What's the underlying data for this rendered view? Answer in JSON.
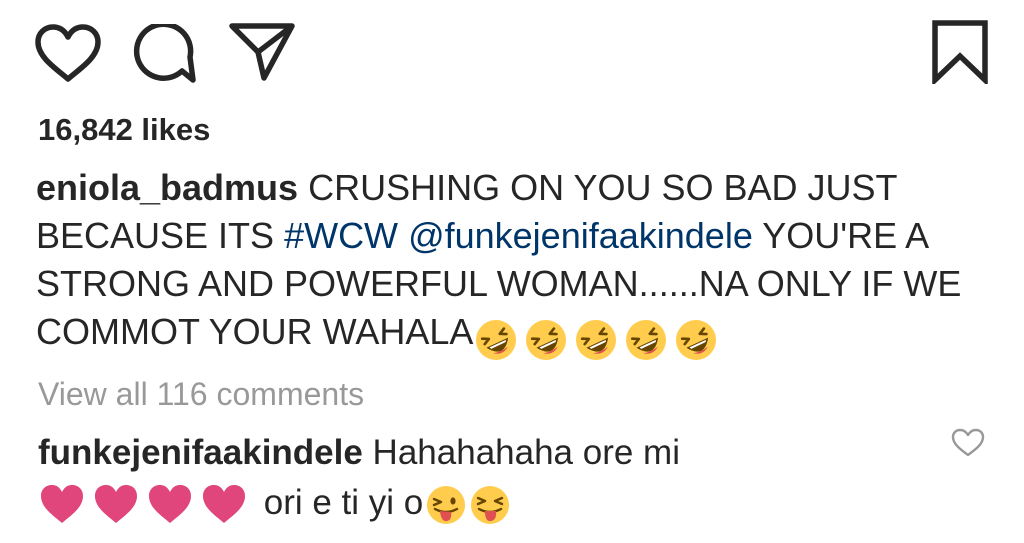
{
  "actions": {
    "like_icon": "heart-outline-icon",
    "comment_icon": "speech-bubble-icon",
    "share_icon": "paper-plane-icon",
    "save_icon": "bookmark-outline-icon"
  },
  "post": {
    "likes": "16,842 likes",
    "caption": {
      "username": "eniola_badmus",
      "text_1": " CRUSHING ON YOU SO BAD JUST BECAUSE ITS ",
      "hashtag": "#WCW",
      "space": " ",
      "mention": "@funkejenifaakindele",
      "text_2": " YOU'RE A STRONG AND POWERFUL WOMAN......NA ONLY IF WE COMMOT YOUR WAHALA",
      "emoji": "rolling-on-floor-laughing-emoji",
      "emoji_count": 5
    },
    "view_comments": "View all 116 comments"
  },
  "comment": {
    "username": "funkejenifaakindele",
    "text_1": " Hahahahaha ore mi ",
    "text_2": " ori e ti yi o",
    "heart_emoji": "red-heart-emoji",
    "heart_count": 4,
    "tongue_emoji": "winking-tongue-emoji",
    "tongue_emoji_2": "squinting-tongue-emoji",
    "like_icon": "small-heart-outline-icon"
  },
  "colors": {
    "text": "#262626",
    "link": "#003569",
    "muted": "#999999",
    "emoji_yellow": "#FFCC4D",
    "heart_pink": "#E0457B"
  }
}
